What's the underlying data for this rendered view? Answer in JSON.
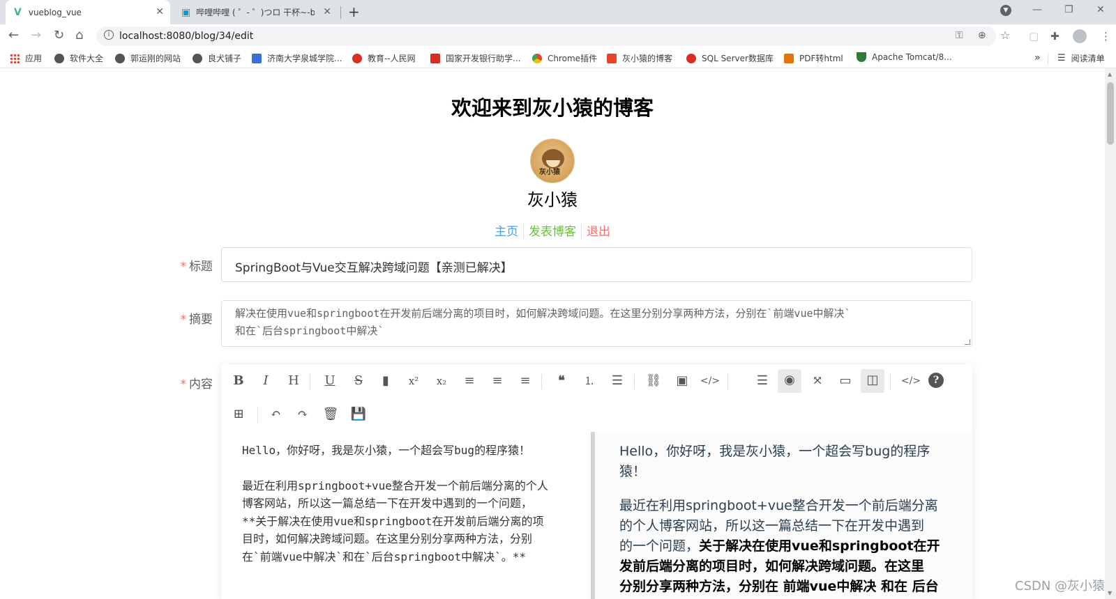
{
  "browser": {
    "tabs": [
      {
        "title": "vueblog_vue",
        "icon": "vue-logo-icon",
        "active": true
      },
      {
        "title": "哔哩哔哩 ( ゜- ゜)つロ 干杯~-bili",
        "icon": "bilibili-icon",
        "active": false
      }
    ],
    "url": "localhost:8080/blog/34/edit",
    "bookmarks": [
      {
        "label": "应用",
        "color": "#4285f4"
      },
      {
        "label": "软件大全",
        "color": "#555555"
      },
      {
        "label": "郭运刚的网站",
        "color": "#555555"
      },
      {
        "label": "良犬铺子",
        "color": "#555555"
      },
      {
        "label": "济南大学泉城学院...",
        "color": "#3b6fd8"
      },
      {
        "label": "教育--人民网",
        "color": "#d93025"
      },
      {
        "label": "国家开发银行助学...",
        "color": "#d93025"
      },
      {
        "label": "Chrome插件",
        "color": "#ea4335"
      },
      {
        "label": "灰小猿的博客",
        "color": "#e8432d"
      },
      {
        "label": "SQL Server数据库",
        "color": "#d93025"
      },
      {
        "label": "PDF转html",
        "color": "#e8710a"
      },
      {
        "label": "Apache Tomcat/8...",
        "color": "#2e7d32"
      }
    ],
    "more_bookmarks": "»",
    "reading_list": "阅读清单"
  },
  "page": {
    "site_title": "欢迎来到灰小猿的博客",
    "avatar_text": "灰小猿",
    "author_name": "灰小猿",
    "nav": {
      "home": "主页",
      "publish": "发表博客",
      "logout": "退出",
      "home_color": "#409eff",
      "publish_color": "#67c23a",
      "logout_color": "#f56c6c"
    }
  },
  "form": {
    "required_mark": "*",
    "title_label": "标题",
    "title_value": "SpringBoot与Vue交互解决跨域问题【亲测已解决】",
    "summary_label": "摘要",
    "summary_line1": "解决在使用vue和springboot在开发前后端分离的项目时，如何解决跨域问题。在这里分别分享两种方法，分别在`前端vue中解决`",
    "summary_line2": "和在`后台springboot中解决`",
    "content_label": "内容"
  },
  "editor": {
    "markdown_lines": [
      "Hello，你好呀，我是灰小猿，一个超会写bug的程序猿！",
      "",
      "最近在利用springboot+vue整合开发一个前后端分离的个人",
      "博客网站，所以这一篇总结一下在开发中遇到的一个问题，",
      "**关于解决在使用vue和springboot在开发前后端分离的项",
      "目时，如何解决跨域问题。在这里分别分享两种方法，分别",
      "在`前端vue中解决`和在`后台springboot中解决`。**"
    ],
    "preview": {
      "line1": "Hello，你好呀，我是灰小猿，一个超会写bug的程序",
      "line2": "猿！",
      "line3": "最近在利用springboot+vue整合开发一个前后端分离",
      "line4": "的个人博客网站，所以这一篇总结一下在开发中遇到",
      "line5_plain": "的一个问题，",
      "line5_bold": "关于解决在使用vue和springboot在开",
      "line6": "发前后端分离的项目时，如何解决跨域问题。在这里",
      "line7": "分别分享两种方法，分别在 前端vue中解决 和在 后台"
    }
  },
  "watermark": "CSDN @灰小猿"
}
